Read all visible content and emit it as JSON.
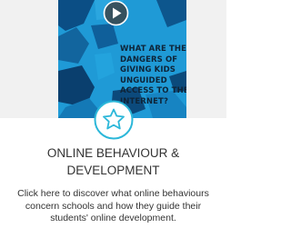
{
  "card": {
    "video": {
      "caption": "WHAT ARE THE DANGERS OF GIVING KIDS UNGUIDED ACCESS TO THE INTERNET?",
      "icon": "play-icon"
    },
    "badge_icon": "star-icon",
    "title": "ONLINE BEHAVIOUR & DEVELOPMENT",
    "description": "Click here to discover what online behaviours concern schools and how they guide their students' online development."
  },
  "colors": {
    "video_blue": "#1f9ad6",
    "accent_cyan": "#2bb7d9",
    "text": "#333333"
  }
}
